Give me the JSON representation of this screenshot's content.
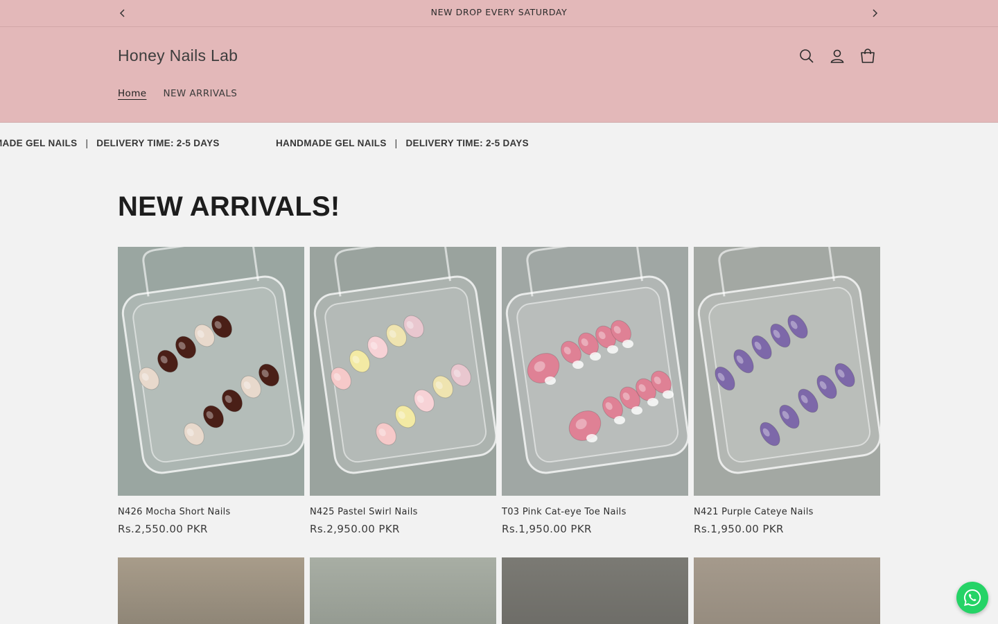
{
  "announcement": {
    "text": "NEW DROP EVERY SATURDAY"
  },
  "header": {
    "brand": "Honey Nails Lab",
    "nav": [
      {
        "label": "Home",
        "active": true
      },
      {
        "label": "NEW ARRIVALS",
        "active": false
      }
    ],
    "icons": [
      "search-icon",
      "account-icon",
      "cart-icon"
    ]
  },
  "marquee": {
    "item_a_cut": "MADE GEL NAILS",
    "item_a": "HANDMADE GEL NAILS",
    "separator": "|",
    "item_b": "DELIVERY TIME: 2-5 DAYS"
  },
  "section": {
    "title": "NEW ARRIVALS!"
  },
  "products": [
    {
      "title": "N426 Mocha Short Nails",
      "price": "Rs.2,550.00 PKR",
      "nail_color": "#4a1f17",
      "bg": "#9aa6a1",
      "style": "mocha"
    },
    {
      "title": "N425 Pastel Swirl Nails",
      "price": "Rs.2,950.00 PKR",
      "nail_color": "#f1e6a0",
      "bg": "#9aa39e",
      "style": "pastel"
    },
    {
      "title": "T03 Pink Cat-eye Toe Nails",
      "price": "Rs.1,950.00 PKR",
      "nail_color": "#df8195",
      "bg": "#a0a7a4",
      "style": "toe"
    },
    {
      "title": "N421 Purple Cateye Nails",
      "price": "Rs.1,950.00 PKR",
      "nail_color": "#7d68a9",
      "bg": "#a3a8a3",
      "style": "purple"
    }
  ],
  "colors": {
    "header_bg": "#e3b8b9",
    "page_bg": "#f2f2f2",
    "whatsapp": "#25d366"
  }
}
